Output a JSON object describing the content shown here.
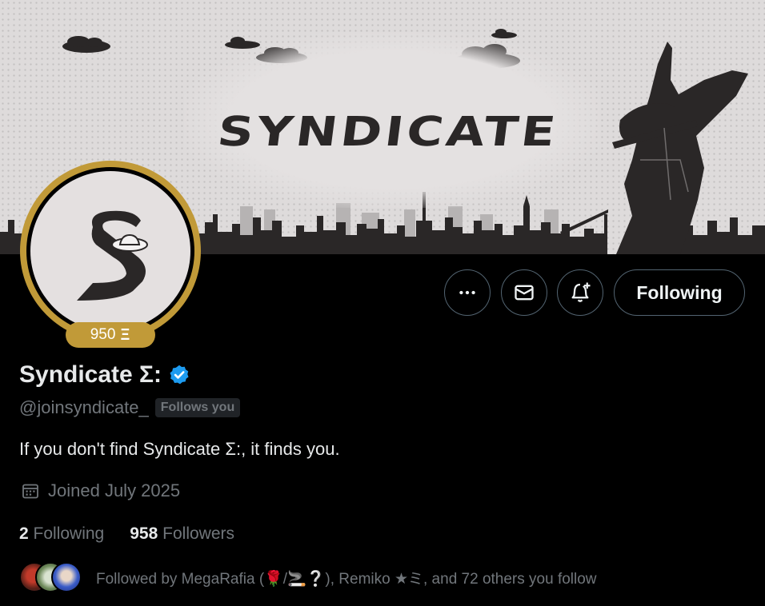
{
  "banner": {
    "title": "SYNDICATE"
  },
  "profile": {
    "score": "950",
    "score_glyph": "Ξ",
    "display_name": "Syndicate Σ:",
    "handle": "@joinsyndicate_",
    "follows_you_label": "Follows you",
    "bio": "If you don't find Syndicate Σ:, it finds you.",
    "joined": "Joined July 2025"
  },
  "actions": {
    "more_icon": "more-horizontal-icon",
    "message_icon": "envelope-icon",
    "notify_icon": "bell-plus-icon",
    "following_label": "Following"
  },
  "stats": {
    "following_count": "2",
    "following_label": "Following",
    "followers_count": "958",
    "followers_label": "Followers"
  },
  "followed_by": {
    "text": "Followed by MegaRafia (🌹/🚬❔), Remiko ★ミ, and 72 others you follow"
  },
  "colors": {
    "gold_ring": "#c19a38",
    "verified_blue": "#1d9bf0",
    "muted_text": "#71767b",
    "border": "#536471"
  }
}
